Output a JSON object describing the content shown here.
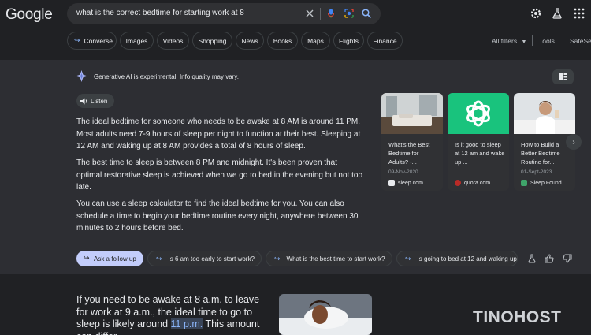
{
  "header": {
    "logo": "Google",
    "search_query": "what is the correct bedtime for starting work at 8",
    "tabs": [
      "Converse",
      "Images",
      "Videos",
      "Shopping",
      "News",
      "Books",
      "Maps",
      "Flights",
      "Finance"
    ],
    "all_filters": "All filters",
    "tools": "Tools",
    "safesearch": "SafeSea"
  },
  "ai": {
    "notice": "Generative AI is experimental. Info quality may vary.",
    "listen": "Listen",
    "paragraphs": [
      "The ideal bedtime for someone who needs to be awake at 8 AM is around 11 PM. Most adults need 7-9 hours of sleep per night to function at their best. Sleeping at 12 AM and waking up at 8 AM provides a total of 8 hours of sleep.",
      "The best time to sleep is between 8 PM and midnight. It's been proven that optimal restorative sleep is achieved when we go to bed in the evening but not too late.",
      "You can use a sleep calculator to find the ideal bedtime for you. You can also schedule a time to begin your bedtime routine every night, anywhere between 30 minutes to 2 hours before bed."
    ],
    "cards": [
      {
        "title": "What's the Best Bedtime for Adults? -...",
        "date": "09-Nov-2020",
        "source": "sleep.com"
      },
      {
        "title": "Is it good to sleep at 12 am and wake up ...",
        "date": "",
        "source": "quora.com"
      },
      {
        "title": "How to Build a Better Bedtime Routine for...",
        "date": "01-Sept-2023",
        "source": "Sleep Found..."
      }
    ],
    "followups": [
      "Ask a follow up",
      "Is 6 am too early to start work?",
      "What is the best time to start work?",
      "Is going to bed at 12 and waking up"
    ]
  },
  "result": {
    "snippet_before": "If you need to be awake at 8 a.m. to leave for work at 9 a.m., the ideal time to go to sleep is likely around ",
    "snippet_highlight": "11 p.m.",
    "snippet_after": " This amount can differ"
  },
  "watermark": "TINOHOST",
  "colors": {
    "accent": "#8ab4f8",
    "chip_primary": "#c3cdfb",
    "background": "#202124",
    "panel": "#2d2e33"
  }
}
